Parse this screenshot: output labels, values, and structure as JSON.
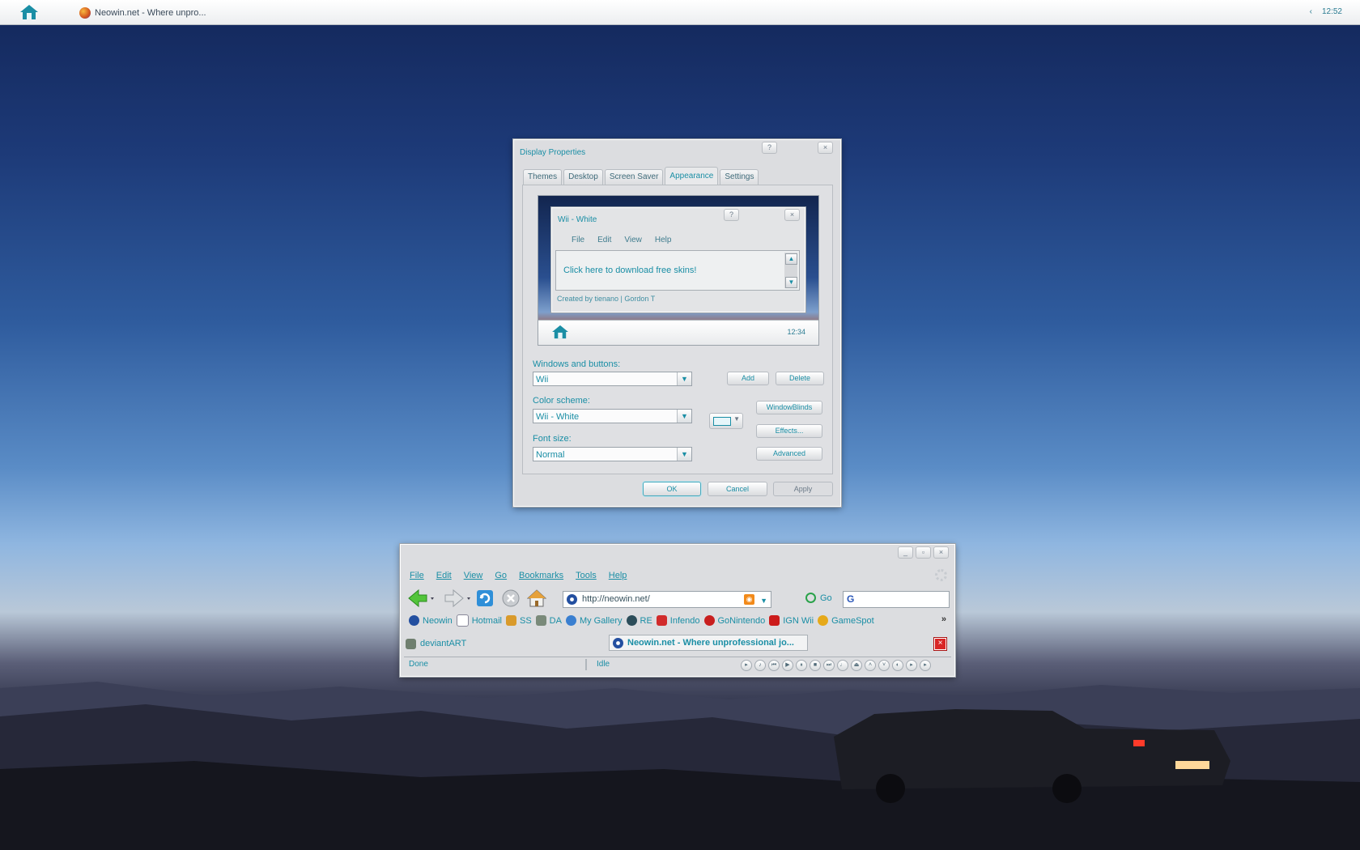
{
  "taskbar": {
    "home_icon": "home-icon",
    "task_label": "Neowin.net - Where unpro...",
    "task_icon": "firefox-icon",
    "tray_arrow": "‹",
    "clock": "12:52"
  },
  "display_properties": {
    "title": "Display Properties",
    "help_btn": "?",
    "close_btn": "×",
    "tabs": [
      "Themes",
      "Desktop",
      "Screen Saver",
      "Appearance",
      "Settings"
    ],
    "active_tab": "Appearance",
    "preview": {
      "window_title": "Wii - White",
      "help_btn": "?",
      "close_btn": "×",
      "menu": [
        "File",
        "Edit",
        "View",
        "Help"
      ],
      "link_text": "Click here to download free skins!",
      "credits": "Created by tienano | Gordon T",
      "clock": "12:34"
    },
    "windows_buttons_label": "Windows and buttons:",
    "windows_buttons_value": "Wii",
    "add_btn": "Add",
    "delete_btn": "Delete",
    "color_scheme_label": "Color scheme:",
    "color_scheme_value": "Wii - White",
    "windowblinds_btn": "WindowBlinds",
    "effects_btn": "Effects...",
    "font_size_label": "Font size:",
    "font_size_value": "Normal",
    "advanced_btn": "Advanced",
    "ok_btn": "OK",
    "cancel_btn": "Cancel",
    "apply_btn": "Apply"
  },
  "firefox": {
    "caption": [
      "_",
      "▫",
      "×"
    ],
    "menu": [
      "File",
      "Edit",
      "View",
      "Go",
      "Bookmarks",
      "Tools",
      "Help"
    ],
    "url": "http://neowin.net/",
    "go_label": "Go",
    "search_engine": "G",
    "bookmarks": [
      {
        "label": "Neowin",
        "icon": "neowin-icon",
        "color": "#234fa0"
      },
      {
        "label": "Hotmail",
        "icon": "page-icon",
        "color": "#ffffff"
      },
      {
        "label": "SS",
        "icon": "ss-icon",
        "color": "#d99a2b"
      },
      {
        "label": "DA",
        "icon": "deviantart-icon",
        "color": "#7a8a7a"
      },
      {
        "label": "My Gallery",
        "icon": "gallery-icon",
        "color": "#3a7fd0"
      },
      {
        "label": "RE",
        "icon": "re-icon",
        "color": "#2c4d5a"
      },
      {
        "label": "Infendo",
        "icon": "infendo-icon",
        "color": "#d12b2b"
      },
      {
        "label": "GoNintendo",
        "icon": "gonintendo-icon",
        "color": "#c81e1e"
      },
      {
        "label": "IGN Wii",
        "icon": "ign-icon",
        "color": "#cc1b1b"
      },
      {
        "label": "GameSpot",
        "icon": "gamespot-icon",
        "color": "#e6a91a"
      }
    ],
    "more_btn": "»",
    "tabs": [
      {
        "label": "deviantART",
        "icon": "deviantart-icon"
      },
      {
        "label": "Neowin.net - Where unprofessional jo...",
        "icon": "neowin-icon"
      }
    ],
    "close_tab_btn": "×",
    "status_text": "Done",
    "player_status": "Idle",
    "media_controls": [
      "▸",
      "♪",
      "⏮",
      "▶",
      "⏸",
      "■",
      "⏭",
      "♩",
      "⏏",
      "˄",
      "˅",
      "◐",
      "▸",
      "▸"
    ]
  }
}
